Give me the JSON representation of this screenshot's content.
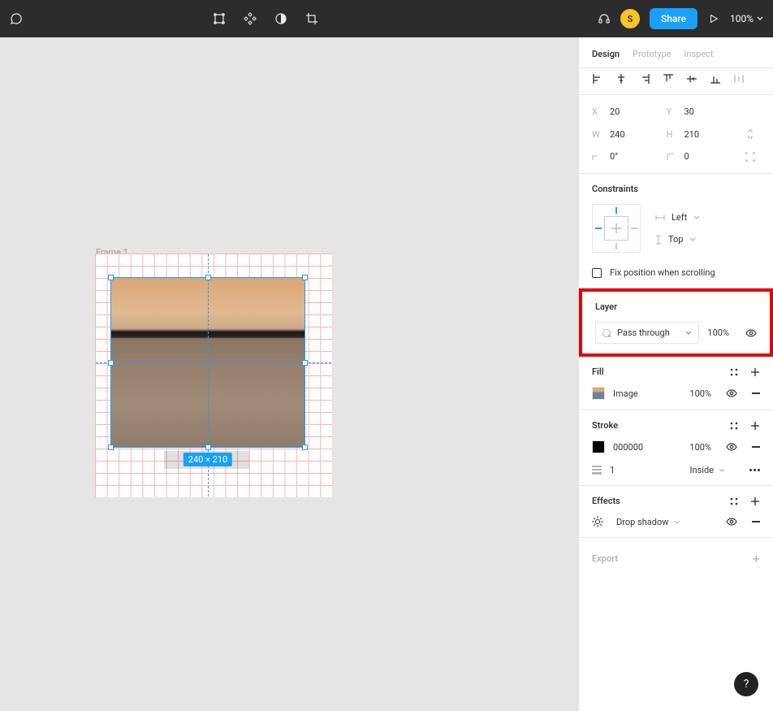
{
  "toolbar": {
    "avatar": "S",
    "share": "Share",
    "zoom": "100%"
  },
  "canvas": {
    "frame_label": "Frame 1",
    "size_badge": "240 × 210"
  },
  "panel": {
    "tabs": {
      "design": "Design",
      "prototype": "Prototype",
      "inspect": "Inspect"
    },
    "position": {
      "x_label": "X",
      "x": "20",
      "y_label": "Y",
      "y": "30",
      "w_label": "W",
      "w": "240",
      "h_label": "H",
      "h": "210",
      "r_label": "",
      "rotation": "0°",
      "c_label": "",
      "corner": "0"
    },
    "constraints": {
      "title": "Constraints",
      "h": "Left",
      "v": "Top",
      "fix": "Fix position when scrolling"
    },
    "layer": {
      "title": "Layer",
      "blend": "Pass through",
      "opacity": "100%"
    },
    "fill": {
      "title": "Fill",
      "type": "Image",
      "opacity": "100%"
    },
    "stroke": {
      "title": "Stroke",
      "color": "000000",
      "opacity": "100%",
      "weight": "1",
      "align": "Inside"
    },
    "effects": {
      "title": "Effects",
      "type": "Drop shadow"
    },
    "export": {
      "title": "Export"
    }
  },
  "help": "?"
}
